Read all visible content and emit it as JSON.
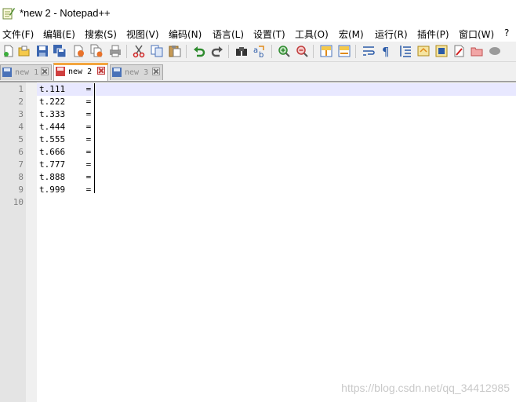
{
  "window": {
    "title": "*new 2 - Notepad++"
  },
  "menu": [
    {
      "label": "文件(F)"
    },
    {
      "label": "编辑(E)"
    },
    {
      "label": "搜索(S)"
    },
    {
      "label": "视图(V)"
    },
    {
      "label": "编码(N)"
    },
    {
      "label": "语言(L)"
    },
    {
      "label": "设置(T)"
    },
    {
      "label": "工具(O)"
    },
    {
      "label": "宏(M)"
    },
    {
      "label": "运行(R)"
    },
    {
      "label": "插件(P)"
    },
    {
      "label": "窗口(W)"
    },
    {
      "label": "?"
    }
  ],
  "toolbar": [
    "new-file-icon",
    "open-file-icon",
    "save-icon",
    "save-all-icon",
    "close-icon",
    "close-all-icon",
    "print-icon",
    "cut-icon",
    "copy-icon",
    "paste-icon",
    "undo-icon",
    "redo-icon",
    "find-icon",
    "replace-icon",
    "zoom-in-icon",
    "zoom-out-icon",
    "sync-vertical-icon",
    "sync-horizontal-icon",
    "word-wrap-icon",
    "show-all-chars-icon",
    "indent-guide-icon",
    "document-map-icon",
    "function-list-icon",
    "folder-workspace-icon",
    "record-macro-icon"
  ],
  "tabs": [
    {
      "label": "new 1",
      "active": false
    },
    {
      "label": "new 2",
      "active": true
    },
    {
      "label": "new 3",
      "active": false
    }
  ],
  "editor": {
    "line_numbers": [
      "1",
      "2",
      "3",
      "4",
      "5",
      "6",
      "7",
      "8",
      "9",
      "10"
    ],
    "lines": [
      "t.111    =",
      "t.222    =",
      "t.333    =",
      "t.444    =",
      "t.555    =",
      "t.666    =",
      "t.777    =",
      "t.888    =",
      "t.999    =",
      ""
    ]
  },
  "watermark": "https://blog.csdn.net/qq_34412985",
  "colors": {
    "active_tab_accent": "#f3a53e",
    "current_line": "#e8e8ff",
    "gutter": "#e4e4e4"
  }
}
